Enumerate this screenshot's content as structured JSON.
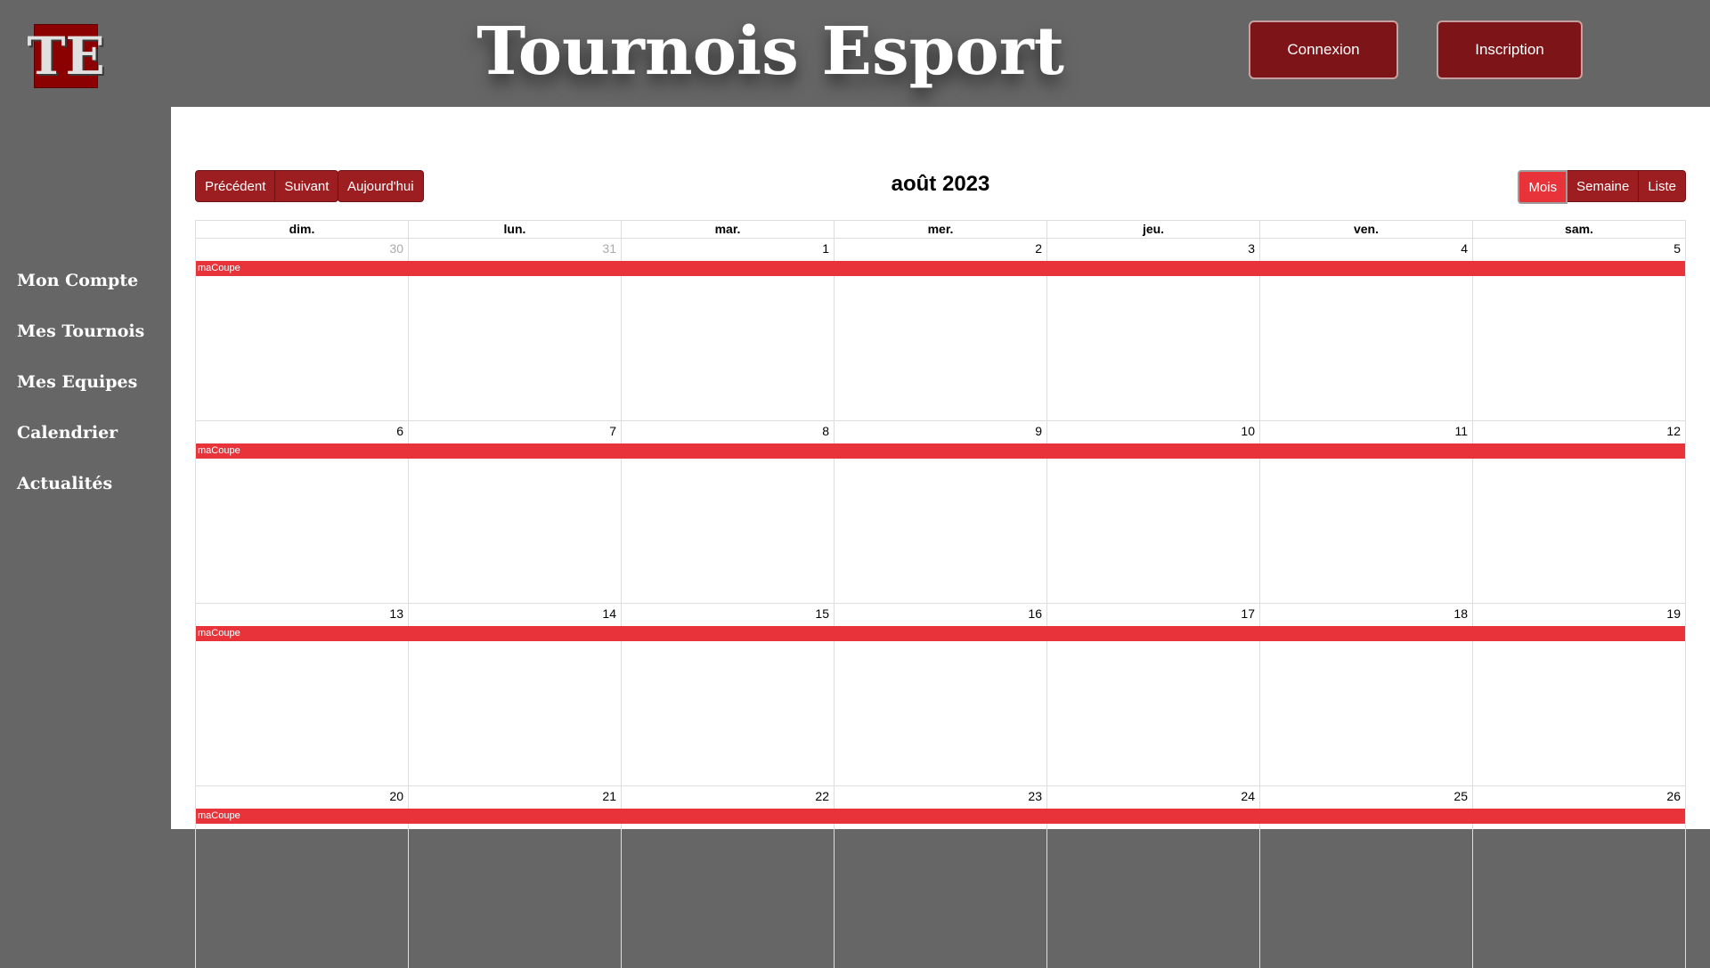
{
  "header": {
    "logo_text": "TE",
    "site_title": "Tournois Esport",
    "login_label": "Connexion",
    "signup_label": "Inscription"
  },
  "sidebar": {
    "items": [
      {
        "label": "Mon Compte"
      },
      {
        "label": "Mes Tournois"
      },
      {
        "label": "Mes Equipes"
      },
      {
        "label": "Calendrier"
      },
      {
        "label": "Actualités"
      }
    ]
  },
  "calendar": {
    "prev_label": "Précédent",
    "next_label": "Suivant",
    "today_label": "Aujourd'hui",
    "title": "août 2023",
    "views": {
      "month": "Mois",
      "week": "Semaine",
      "list": "Liste"
    },
    "active_view": "month",
    "days_of_week": [
      "dim.",
      "lun.",
      "mar.",
      "mer.",
      "jeu.",
      "ven.",
      "sam."
    ],
    "weeks": [
      {
        "days": [
          "30",
          "31",
          "1",
          "2",
          "3",
          "4",
          "5"
        ],
        "event": "maCoupe"
      },
      {
        "days": [
          "6",
          "7",
          "8",
          "9",
          "10",
          "11",
          "12"
        ],
        "event": "maCoupe"
      },
      {
        "days": [
          "13",
          "14",
          "15",
          "16",
          "17",
          "18",
          "19"
        ],
        "event": "maCoupe"
      },
      {
        "days": [
          "20",
          "21",
          "22",
          "23",
          "24",
          "25",
          "26"
        ],
        "event": "maCoupe"
      }
    ],
    "event_color": "#e8333b"
  },
  "colors": {
    "background": "#666666",
    "brand_dark_red": "#7d1518",
    "accent_red": "#e8333b"
  }
}
